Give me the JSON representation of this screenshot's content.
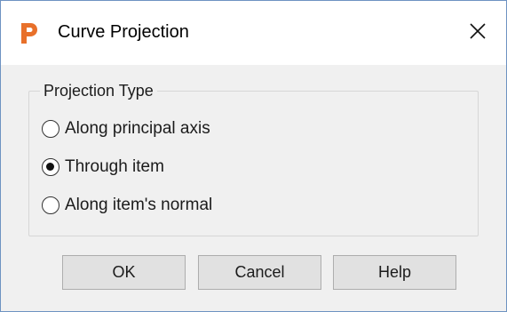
{
  "window": {
    "title": "Curve Projection",
    "icon": "app-logo-p",
    "close_icon": "close-icon"
  },
  "group": {
    "legend": "Projection Type",
    "options": [
      {
        "label": "Along principal axis",
        "checked": false
      },
      {
        "label": "Through item",
        "checked": true
      },
      {
        "label": "Along item's normal",
        "checked": false
      }
    ]
  },
  "buttons": {
    "ok": "OK",
    "cancel": "Cancel",
    "help": "Help"
  },
  "colors": {
    "accent_icon": "#e8702a",
    "dialog_bg": "#f0f0f0",
    "button_bg": "#e1e1e1"
  }
}
